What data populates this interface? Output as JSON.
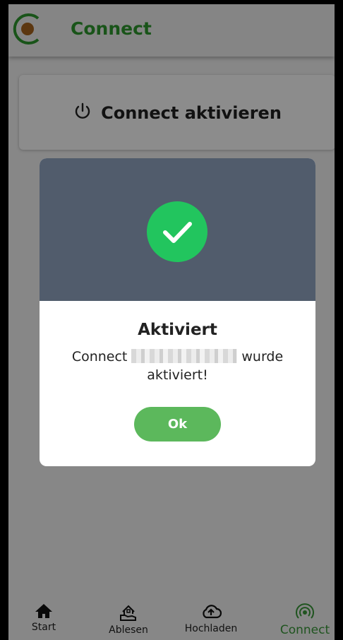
{
  "header": {
    "title": "Connect"
  },
  "card": {
    "label": "Connect aktivieren"
  },
  "dialog": {
    "title": "Aktiviert",
    "message_before": "Connect",
    "message_after": "wurde aktiviert!",
    "ok_label": "Ok"
  },
  "nav": [
    {
      "label": "Start",
      "icon": "home-icon"
    },
    {
      "label": "Ablesen",
      "icon": "reading-icon"
    },
    {
      "label": "Hochladen",
      "icon": "cloud-upload-icon"
    },
    {
      "label": "Connect",
      "icon": "signal-icon",
      "active": true
    }
  ],
  "colors": {
    "brand_green": "#2f9a2f",
    "success": "#22c55e",
    "button": "#5cb85c",
    "dialog_header": "#515c6c"
  }
}
